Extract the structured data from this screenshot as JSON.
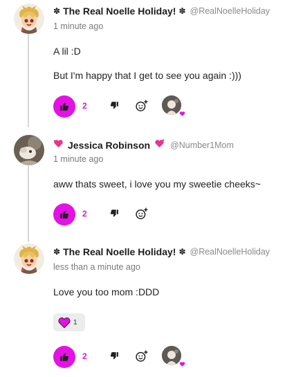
{
  "comments": [
    {
      "author": "The Real Noelle Holiday!",
      "handle": "@RealNoelleHoliday",
      "time": "1 minute ago",
      "lines": [
        "A lil :D",
        "But I'm happy that I get to see you again :)))"
      ],
      "likes": "2"
    },
    {
      "author": "Jessica Robinson",
      "handle": "@Number1Mom",
      "time": "1 minute ago",
      "lines": [
        "aww thats sweet, i love you my sweetie cheeks~"
      ],
      "likes": "2"
    },
    {
      "author": "The Real Noelle Holiday!",
      "handle": "@RealNoelleHoliday",
      "time": "less than a minute ago",
      "lines": [
        "Love you too mom :DDD"
      ],
      "likes": "2",
      "reaction_count": "1"
    }
  ],
  "icons": {
    "like": "thumbs-up-icon",
    "dislike": "thumbs-down-icon",
    "react": "add-reaction-icon",
    "name_decoration": "flower-icon",
    "jessica_decoration": "sparkling-heart-icon",
    "reaction": "heart-icon"
  },
  "colors": {
    "accent": "#e511e5",
    "text": "#222222",
    "muted": "#7a7a7a",
    "thread_line": "#d6d6d6"
  }
}
